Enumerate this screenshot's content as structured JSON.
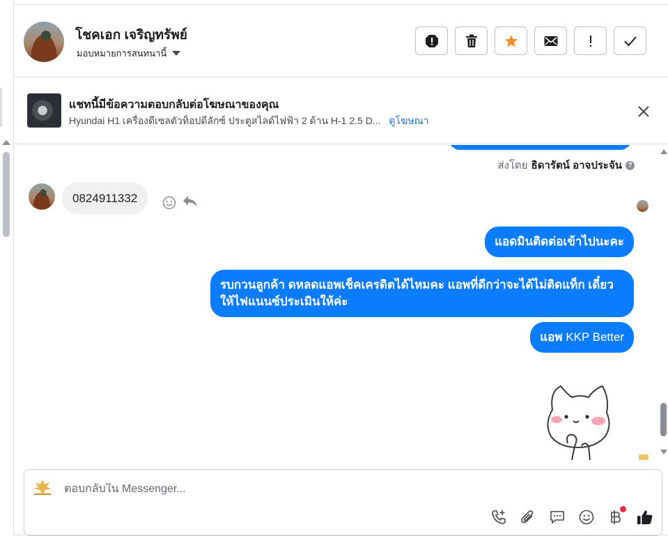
{
  "header": {
    "contact_name": "โชคเอก เจริญทรัพย์",
    "assign_label": "มอบหมายการสนทนานี้"
  },
  "actions": [
    {
      "name": "spam-button",
      "icon": "octagon-alert-icon"
    },
    {
      "name": "delete-button",
      "icon": "trash-icon"
    },
    {
      "name": "star-button",
      "icon": "star-icon",
      "color": "#f28c28"
    },
    {
      "name": "mark-unread-button",
      "icon": "envelope-icon"
    },
    {
      "name": "follow-up-button",
      "icon": "exclamation-icon"
    },
    {
      "name": "done-button",
      "icon": "check-icon"
    }
  ],
  "ad_banner": {
    "title": "แชทนี้มีข้อความตอบกลับต่อโฆษณาของคุณ",
    "description": "Hyundai H1 เครื่องดีเซลตัวท็อปดีลักซ์ ประตูสไลด์ไฟฟ้า 2 ด้าน H-1 2.5 D...",
    "link_label": "ดูโฆษณา"
  },
  "conversation": {
    "sent_by_prefix": "ส่งโดย",
    "sent_by_name": "ธิดารัตน์ อาจประจัน",
    "incoming_message": "0824911332",
    "outgoing_messages": [
      "แอดมินติดต่อเข้าไปนะคะ",
      "รบกวนลูกค้า ดหลดแอพเช็คเครดิตได้ไหมคะ แอพที่ดีกว่าจะได้ไม่ติดแท็ก เดี๋ยวให้ไฟแนนซ์ประเมินให้ค่ะ",
      {
        "prefix": "แอพ",
        "rest": " KKP Better"
      }
    ]
  },
  "composer": {
    "placeholder": "ตอบกลับใน Messenger..."
  },
  "colors": {
    "bubble_outgoing": "#0a7cff",
    "bubble_incoming": "#f0f0f0",
    "link": "#216fdb",
    "badge": "#f02849"
  }
}
